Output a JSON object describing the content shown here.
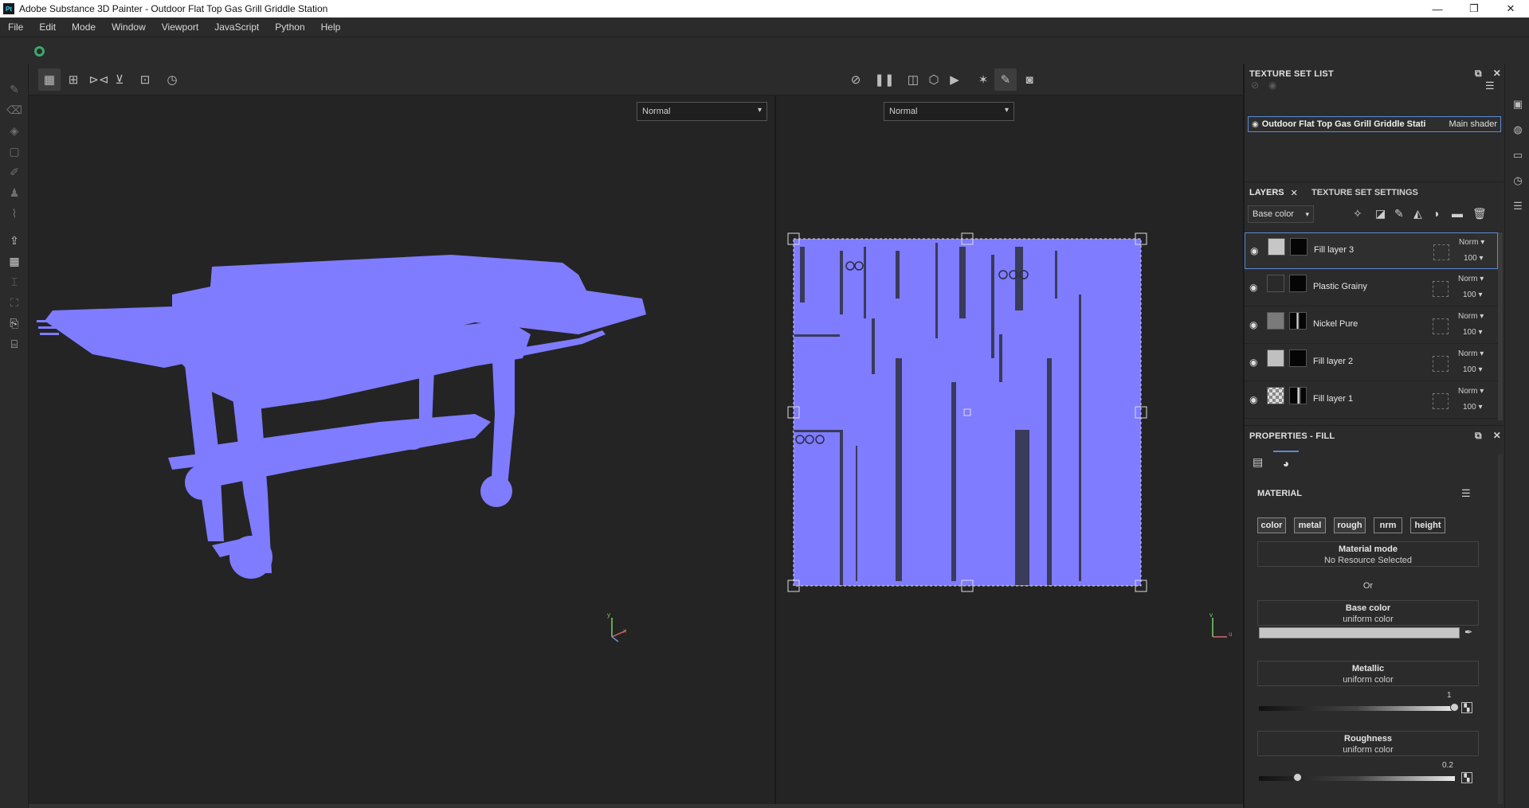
{
  "app": {
    "title": "Adobe Substance 3D Painter - Outdoor Flat Top Gas Grill Griddle Station",
    "logo_text": "Pt",
    "controls": [
      "—",
      "❐",
      "✕"
    ]
  },
  "menu": [
    "File",
    "Edit",
    "Mode",
    "Window",
    "Viewport",
    "JavaScript",
    "Python",
    "Help"
  ],
  "viewport": {
    "left_mode": "Normal",
    "right_mode": "Normal",
    "mesh_color": "#7f7cff",
    "axis_3d": [
      "y",
      "x"
    ],
    "axis_2d": [
      "v",
      "u"
    ]
  },
  "texture_set_list": {
    "title": "TEXTURE SET LIST",
    "item_name": "Outdoor Flat Top Gas Grill Griddle Stati",
    "item_shader": "Main shader"
  },
  "layers_panel": {
    "tab_layers": "LAYERS",
    "tab_settings": "TEXTURE SET SETTINGS",
    "channel": "Base color",
    "layers": [
      {
        "name": "Fill layer 3",
        "blend": "Norm",
        "opacity": "100",
        "selected": true
      },
      {
        "name": "Plastic Grainy",
        "blend": "Norm",
        "opacity": "100",
        "selected": false
      },
      {
        "name": "Nickel Pure",
        "blend": "Norm",
        "opacity": "100",
        "selected": false
      },
      {
        "name": "Fill layer 2",
        "blend": "Norm",
        "opacity": "100",
        "selected": false
      },
      {
        "name": "Fill layer 1",
        "blend": "Norm",
        "opacity": "100",
        "selected": false
      }
    ]
  },
  "properties": {
    "title": "PROPERTIES - FILL",
    "material_label": "MATERIAL",
    "channels": [
      "color",
      "metal",
      "rough",
      "nrm",
      "height"
    ],
    "material_mode": {
      "label": "Material mode",
      "value": "No Resource Selected"
    },
    "or_label": "Or",
    "base_color": {
      "label": "Base color",
      "value": "uniform color",
      "color": "#c6c6c6"
    },
    "metallic": {
      "label": "Metallic",
      "value": "uniform color",
      "amount": "1",
      "fraction": 1.0
    },
    "roughness": {
      "label": "Roughness",
      "value": "uniform color",
      "amount": "0.2",
      "fraction": 0.2
    }
  }
}
